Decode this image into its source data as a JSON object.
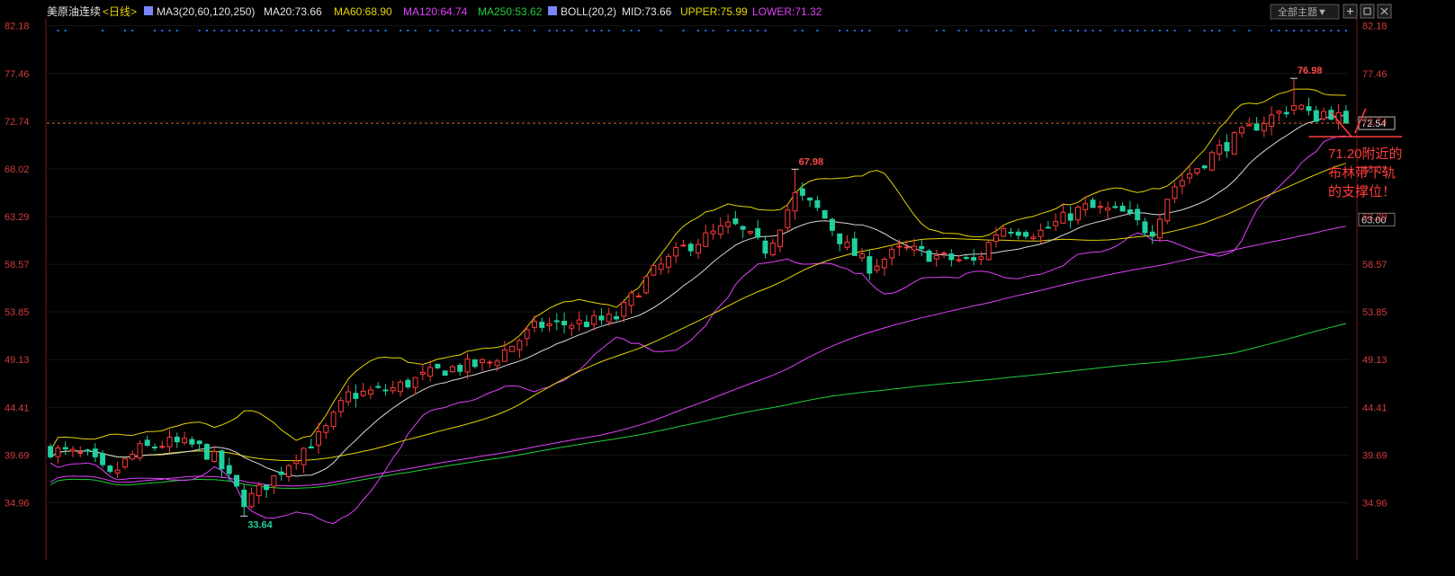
{
  "header": {
    "symbol": "美原油连续",
    "period": "<日线>",
    "ma_label": "MA3(20,60,120,250)",
    "ma20": "MA20:73.66",
    "ma60": "MA60:68.90",
    "ma120": "MA120:64.74",
    "ma250": "MA250:53.62",
    "boll_label": "BOLL(20,2)",
    "mid": "MID:73.66",
    "upper": "UPPER:75.99",
    "lower": "LOWER:71.32",
    "theme_button": "全部主题▼"
  },
  "colors": {
    "up": "#ff3b3b",
    "down": "#21d0a0",
    "ma20": "#d8d8d8",
    "ma60": "#e6d400",
    "ma120": "#e040fb",
    "ma250": "#1fcf3a",
    "boll": "#e6d400",
    "axis_text": "#d23c3c",
    "header_text": "#e0e0e0",
    "dot_row": "#1e78ff"
  },
  "chart_data": {
    "type": "candlestick",
    "y_ticks": [
      "82.18",
      "77.46",
      "72.74",
      "68.02",
      "63.29",
      "58.57",
      "53.85",
      "49.13",
      "44.41",
      "39.69",
      "34.96"
    ],
    "ylim": [
      31.0,
      82.6
    ],
    "n_bars": 175,
    "keypoints": [
      [
        0,
        40.2
      ],
      [
        8,
        39.5
      ],
      [
        12,
        37.5
      ],
      [
        18,
        40.2
      ],
      [
        24,
        40.9
      ],
      [
        30,
        40.6
      ],
      [
        34,
        39.2
      ],
      [
        40,
        35.0
      ],
      [
        46,
        37.5
      ],
      [
        51,
        40.0
      ],
      [
        56,
        41.8
      ],
      [
        61,
        45.6
      ],
      [
        70,
        46.2
      ],
      [
        80,
        48.1
      ],
      [
        90,
        48.8
      ],
      [
        100,
        52.5
      ],
      [
        110,
        52.8
      ],
      [
        116,
        53.2
      ],
      [
        123,
        57.5
      ],
      [
        130,
        60.2
      ],
      [
        140,
        62.5
      ],
      [
        147,
        60.0
      ],
      [
        153,
        65.5
      ],
      [
        158,
        63.8
      ],
      [
        163,
        60.5
      ],
      [
        168,
        58.3
      ],
      [
        175,
        60.1
      ],
      [
        183,
        59.2
      ],
      [
        190,
        58.8
      ],
      [
        195,
        62.3
      ],
      [
        203,
        61.7
      ],
      [
        212,
        64.2
      ],
      [
        220,
        63.7
      ],
      [
        226,
        61.7
      ],
      [
        230,
        66.0
      ],
      [
        240,
        70.0
      ],
      [
        248,
        72.5
      ],
      [
        256,
        74.5
      ],
      [
        259,
        73.0
      ],
      [
        262,
        73.8
      ],
      [
        266,
        72.7
      ]
    ],
    "high_label": "67.98",
    "high_value": 67.98,
    "high2_label": "76.98",
    "high2_value": 76.98,
    "low_label": "33.64",
    "low_value": 33.64,
    "last_price": "72.54",
    "last_value": 72.54,
    "ref_line_label": "63.00",
    "ref_line_value": 63.0,
    "annotation": [
      "71.20附近的",
      "布林带下轨",
      "的支撑位！"
    ],
    "annotation_value": 71.2
  }
}
